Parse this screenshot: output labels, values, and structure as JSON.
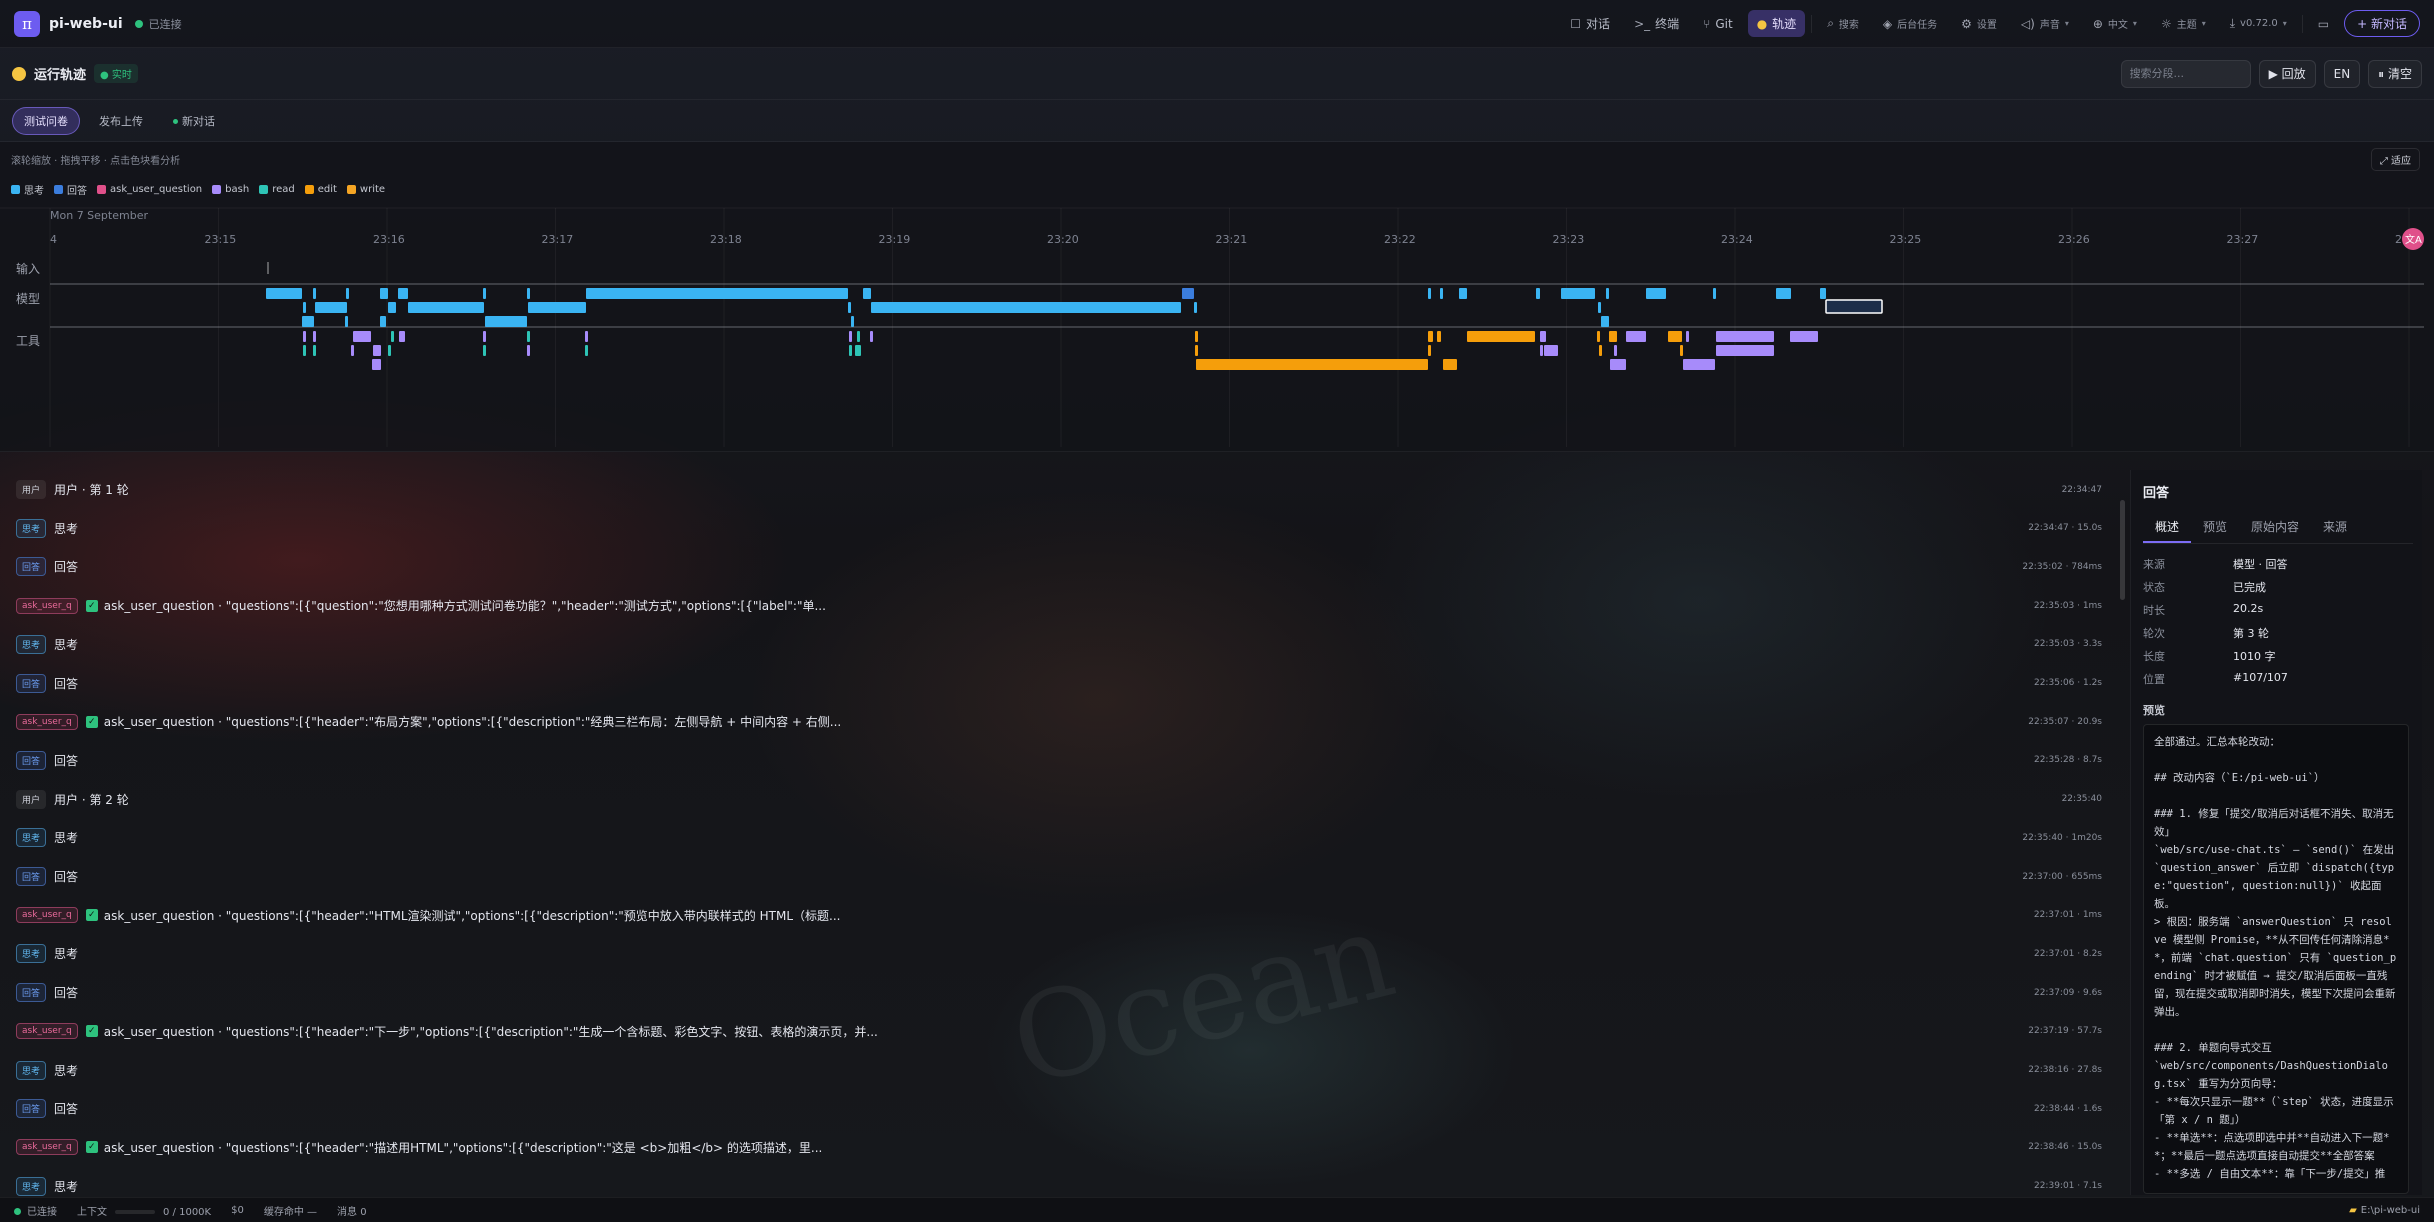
{
  "topbar": {
    "logo": "π",
    "app_name": "pi-web-ui",
    "status": "已连接",
    "nav": [
      {
        "icon": "chat-icon",
        "glyph": "☐",
        "label": "对话"
      },
      {
        "icon": "terminal-icon",
        "glyph": ">_",
        "label": "终端"
      },
      {
        "icon": "git-icon",
        "glyph": "⑂",
        "label": "Git"
      },
      {
        "icon": "trace-icon",
        "glyph": "●",
        "label": "轨迹",
        "active": true
      },
      {
        "icon": "search-icon",
        "glyph": "⌕",
        "label": "搜索"
      },
      {
        "icon": "layers-icon",
        "glyph": "◈",
        "label": "后台任务"
      },
      {
        "icon": "gear-icon",
        "glyph": "⚙",
        "label": "设置"
      },
      {
        "icon": "sound-icon",
        "glyph": "◁)",
        "label": "声音"
      },
      {
        "icon": "globe-icon",
        "glyph": "⊕",
        "label": "中文"
      },
      {
        "icon": "sun-icon",
        "glyph": "☼",
        "label": "主题"
      },
      {
        "icon": "download-icon",
        "glyph": "⤓",
        "label": "v0.72.0"
      }
    ],
    "new_chat": "+ 新对话"
  },
  "header": {
    "title": "运行轨迹",
    "live": "● 实时",
    "search_placeholder": "搜索分段...",
    "replay": "▶ 回放",
    "lang": "EN",
    "clear": "⏸ 清空"
  },
  "tabs": [
    {
      "label": "测试问卷",
      "active": true
    },
    {
      "label": "发布上传"
    },
    {
      "label": "新对话",
      "dot": true
    }
  ],
  "timeline": {
    "hint": "滚轮缩放 · 拖拽平移 · 点击色块看分析",
    "fit": "⤢ 适应",
    "date": "Mon 7 September",
    "ticks": [
      "4",
      "23:15",
      "23:16",
      "23:17",
      "23:18",
      "23:19",
      "23:20",
      "23:21",
      "23:22",
      "23:23",
      "23:24",
      "23:25",
      "23:26",
      "23:27",
      "23:2"
    ],
    "lanes": [
      "输入",
      "模型",
      "工具"
    ],
    "legend": [
      {
        "name": "思考",
        "color": "#3ab4f2"
      },
      {
        "name": "回答",
        "color": "#3b7ddd"
      },
      {
        "name": "ask_user_question",
        "color": "#e0508a"
      },
      {
        "name": "bash",
        "color": "#a78bfa"
      },
      {
        "name": "read",
        "color": "#2ec4b6"
      },
      {
        "name": "edit",
        "color": "#f59e0b"
      },
      {
        "name": "write",
        "color": "#f5a524"
      }
    ]
  },
  "rows": [
    {
      "kind": "user",
      "tag": "用户",
      "label": "用户 · 第 1 轮",
      "time": "22:34:47"
    },
    {
      "kind": "think",
      "tag": "思考",
      "label": "思考",
      "time": "22:34:47 · 15.0s"
    },
    {
      "kind": "answer",
      "tag": "回答",
      "label": "回答",
      "time": "22:35:02 · 784ms"
    },
    {
      "kind": "ask",
      "tag": "ask_user_q",
      "label": "ask_user_question · \"questions\":[{\"question\":\"您想用哪种方式测试问卷功能？\",\"header\":\"测试方式\",\"options\":[{\"label\":\"单...",
      "time": "22:35:03 · 1ms"
    },
    {
      "kind": "think",
      "tag": "思考",
      "label": "思考",
      "time": "22:35:03 · 3.3s"
    },
    {
      "kind": "answer",
      "tag": "回答",
      "label": "回答",
      "time": "22:35:06 · 1.2s"
    },
    {
      "kind": "ask",
      "tag": "ask_user_q",
      "label": "ask_user_question · \"questions\":[{\"header\":\"布局方案\",\"options\":[{\"description\":\"经典三栏布局：左侧导航 + 中间内容 + 右侧...",
      "time": "22:35:07 · 20.9s"
    },
    {
      "kind": "answer",
      "tag": "回答",
      "label": "回答",
      "time": "22:35:28 · 8.7s"
    },
    {
      "kind": "user",
      "tag": "用户",
      "label": "用户 · 第 2 轮",
      "time": "22:35:40"
    },
    {
      "kind": "think",
      "tag": "思考",
      "label": "思考",
      "time": "22:35:40 · 1m20s"
    },
    {
      "kind": "answer",
      "tag": "回答",
      "label": "回答",
      "time": "22:37:00 · 655ms"
    },
    {
      "kind": "ask",
      "tag": "ask_user_q",
      "label": "ask_user_question · \"questions\":[{\"header\":\"HTML渲染测试\",\"options\":[{\"description\":\"预览中放入带内联样式的 HTML（标题...",
      "time": "22:37:01 · 1ms"
    },
    {
      "kind": "think",
      "tag": "思考",
      "label": "思考",
      "time": "22:37:01 · 8.2s"
    },
    {
      "kind": "answer",
      "tag": "回答",
      "label": "回答",
      "time": "22:37:09 · 9.6s"
    },
    {
      "kind": "ask",
      "tag": "ask_user_q",
      "label": "ask_user_question · \"questions\":[{\"header\":\"下一步\",\"options\":[{\"description\":\"生成一个含标题、彩色文字、按钮、表格的演示页，并...",
      "time": "22:37:19 · 57.7s"
    },
    {
      "kind": "think",
      "tag": "思考",
      "label": "思考",
      "time": "22:38:16 · 27.8s"
    },
    {
      "kind": "answer",
      "tag": "回答",
      "label": "回答",
      "time": "22:38:44 · 1.6s"
    },
    {
      "kind": "ask",
      "tag": "ask_user_q",
      "label": "ask_user_question · \"questions\":[{\"header\":\"描述用HTML\",\"options\":[{\"description\":\"这是 <b>加粗</b> 的选项描述，里...",
      "time": "22:38:46 · 15.0s"
    },
    {
      "kind": "think",
      "tag": "思考",
      "label": "思考",
      "time": "22:39:01 · 7.1s"
    }
  ],
  "panel": {
    "title": "回答",
    "tabs": [
      "概述",
      "预览",
      "原始内容",
      "来源"
    ],
    "fields": [
      {
        "k": "来源",
        "v": "模型 · 回答"
      },
      {
        "k": "状态",
        "v": "已完成"
      },
      {
        "k": "时长",
        "v": "20.2s"
      },
      {
        "k": "轮次",
        "v": "第 3 轮"
      },
      {
        "k": "长度",
        "v": "1010 字"
      },
      {
        "k": "位置",
        "v": "#107/107"
      }
    ],
    "preview_label": "预览",
    "preview": "全部通过。汇总本轮改动：\n\n## 改动内容（`E:/pi-web-ui`）\n\n### 1. 修复「提交/取消后对话框不消失、取消无效」\n`web/src/use-chat.ts` — `send()` 在发出 `question_answer` 后立即 `dispatch({type:\"question\", question:null})` 收起面板。\n> 根因：服务端 `answerQuestion` 只 resolve 模型侧 Promise，**从不回传任何清除消息**，前端 `chat.question` 只有 `question_pending` 时才被赋值 → 提交/取消后面板一直残留，现在提交或取消即时消失，模型下次提问会重新弹出。\n\n### 2. 单题向导式交互\n`web/src/components/DashQuestionDialog.tsx` 重写为分页向导：\n- **每次只显示一题**（`step` 状态，进度显示「第 x / n 题」）\n- **单选**：点选项即选中并**自动进入下一题**；**最后一题点选项直接自动提交**全部答案\n- **多选 / 自由文本**：靠「下一步/提交」推"
  },
  "statusbar": {
    "status": "已连接",
    "context_label": "上下文",
    "context_value": "0 / 1000K",
    "cost": "$0",
    "cache": "缓存命中 —",
    "messages": "消息 0",
    "path": "E:\\pi-web-ui"
  }
}
